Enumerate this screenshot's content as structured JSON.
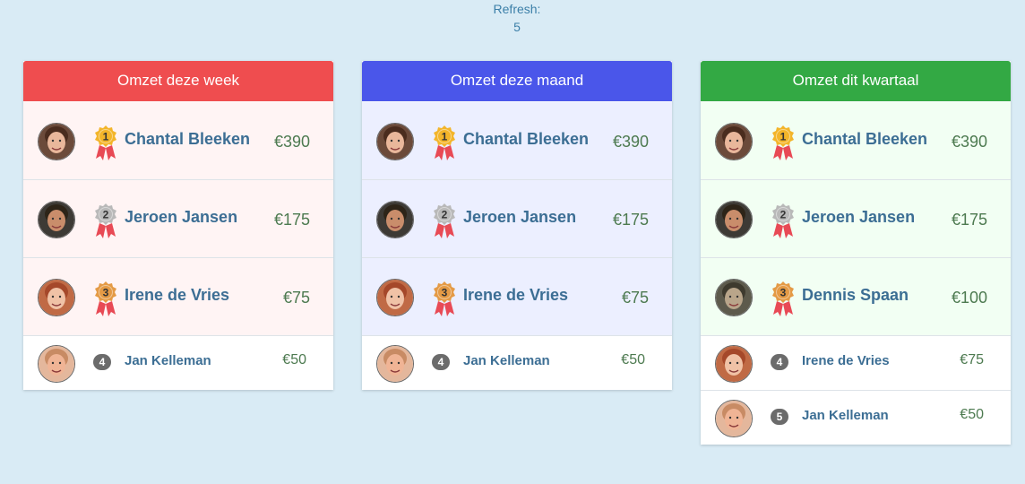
{
  "refresh": {
    "label": "Refresh:",
    "value": "5"
  },
  "panels": [
    {
      "title": "Omzet deze week",
      "header_color": "#ef4d4f",
      "row_bg": "#fff4f4",
      "rows": [
        {
          "rank": "1",
          "name": "Chantal Bleeken",
          "amount": "€390",
          "avatar": "woman-brown-hair"
        },
        {
          "rank": "2",
          "name": "Jeroen Jansen",
          "amount": "€175",
          "avatar": "man-dark-hair"
        },
        {
          "rank": "3",
          "name": "Irene de Vries",
          "amount": "€75",
          "avatar": "woman-red-hair"
        },
        {
          "rank": "4",
          "name": "Jan Kelleman",
          "amount": "€50",
          "avatar": "man-light-hair"
        }
      ]
    },
    {
      "title": "Omzet deze maand",
      "header_color": "#4a56ea",
      "row_bg": "#ecefff",
      "rows": [
        {
          "rank": "1",
          "name": "Chantal Bleeken",
          "amount": "€390",
          "avatar": "woman-brown-hair"
        },
        {
          "rank": "2",
          "name": "Jeroen Jansen",
          "amount": "€175",
          "avatar": "man-dark-hair"
        },
        {
          "rank": "3",
          "name": "Irene de Vries",
          "amount": "€75",
          "avatar": "woman-red-hair"
        },
        {
          "rank": "4",
          "name": "Jan Kelleman",
          "amount": "€50",
          "avatar": "man-light-hair"
        }
      ]
    },
    {
      "title": "Omzet dit kwartaal",
      "header_color": "#33a944",
      "row_bg": "#f2fff3",
      "rows": [
        {
          "rank": "1",
          "name": "Chantal Bleeken",
          "amount": "€390",
          "avatar": "woman-brown-hair"
        },
        {
          "rank": "2",
          "name": "Jeroen Jansen",
          "amount": "€175",
          "avatar": "man-dark-hair"
        },
        {
          "rank": "3",
          "name": "Dennis Spaan",
          "amount": "€100",
          "avatar": "man-outdoor-photo"
        },
        {
          "rank": "4",
          "name": "Irene de Vries",
          "amount": "€75",
          "avatar": "woman-red-hair"
        },
        {
          "rank": "5",
          "name": "Jan Kelleman",
          "amount": "€50",
          "avatar": "man-light-hair"
        }
      ]
    }
  ],
  "medal_colors": {
    "1": "#f3b52a",
    "2": "#b9b9b9",
    "3": "#e49a45",
    "ribbon": "#e84a55"
  }
}
